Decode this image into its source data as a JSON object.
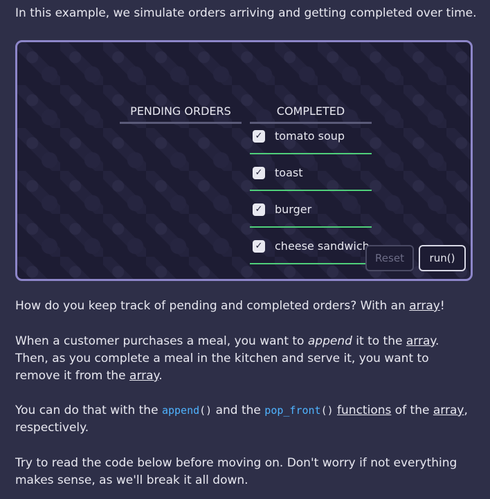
{
  "intro": "In this example, we simulate orders arriving and getting completed over time.",
  "demo": {
    "pending_header": "PENDING ORDERS",
    "completed_header": "COMPLETED",
    "completed_orders": [
      "tomato soup",
      "toast",
      "burger",
      "cheese sandwich"
    ],
    "reset_label": "Reset",
    "run_label": "run()"
  },
  "p1": {
    "before": "How do you keep track of pending and completed orders? With an ",
    "link": "array",
    "after": "!"
  },
  "p2": {
    "a": "When a customer purchases a meal, you want to ",
    "em": "append",
    "b": " it to the ",
    "link1": "array",
    "c": ". Then, as you complete a meal in the kitchen and serve it, you want to remove it from the ",
    "link2": "array",
    "d": "."
  },
  "p3": {
    "a": "You can do that with the ",
    "code1_name": "append",
    "code1_parens": "()",
    "b": " and the ",
    "code2_name": "pop_front",
    "code2_parens": "()",
    "c": " ",
    "link1": "functions",
    "d": " of the ",
    "link2": "array",
    "e": ", respectively."
  },
  "p4": "Try to read the code below before moving on. Don't worry if not everything makes sense, as we'll break it all down.",
  "colors": {
    "accent_border": "#8d86c9",
    "check_line": "#4fcf7a",
    "code_fn": "#4fb3ff"
  }
}
